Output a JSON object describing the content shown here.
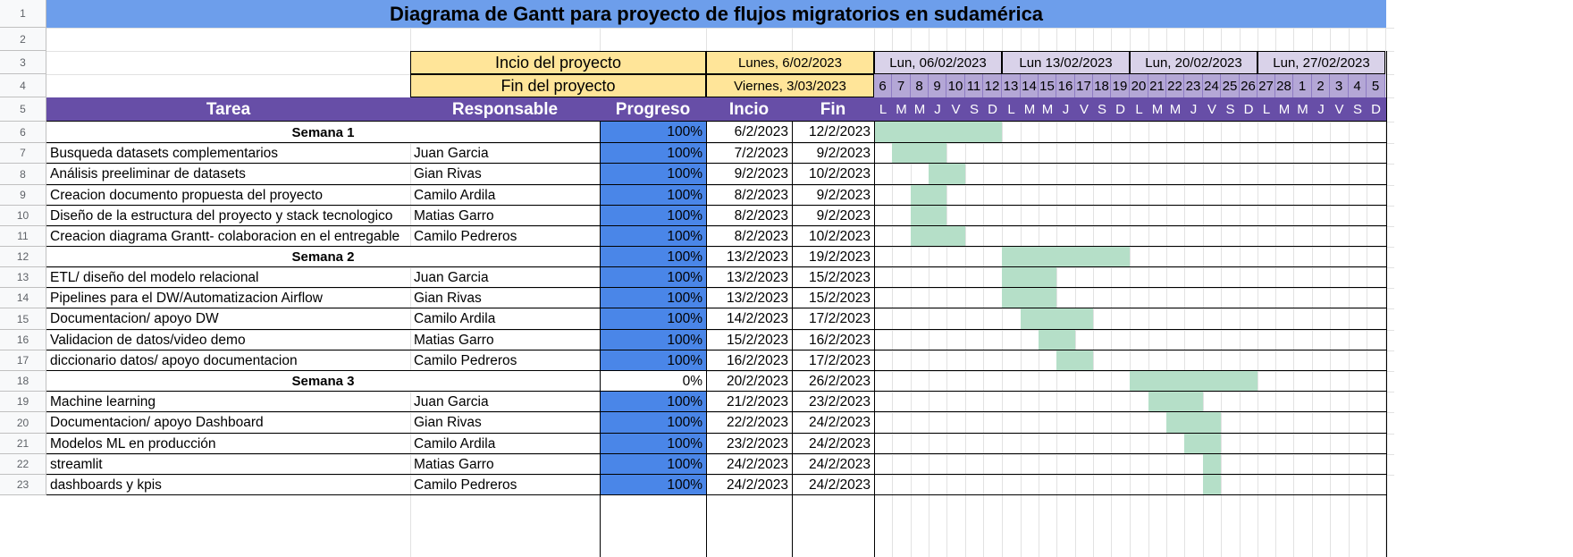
{
  "title": "Diagrama de Gantt para proyecto de flujos migratorios en sudamérica",
  "project": {
    "start_label": "Incio del proyecto",
    "start_value": "Lunes, 6/02/2023",
    "end_label": "Fin del proyecto",
    "end_value": "Viernes, 3/03/2023"
  },
  "weeks": [
    "Lun, 06/02/2023",
    "Lun 13/02/2023",
    "Lun, 20/02/2023",
    "Lun, 27/02/2023"
  ],
  "day_numbers": [
    "6",
    "7",
    "8",
    "9",
    "10",
    "11",
    "12",
    "13",
    "14",
    "15",
    "16",
    "17",
    "18",
    "19",
    "20",
    "21",
    "22",
    "23",
    "24",
    "25",
    "26",
    "27",
    "28",
    "1",
    "2",
    "3",
    "4",
    "5"
  ],
  "day_letters": [
    "L",
    "M",
    "M",
    "J",
    "V",
    "S",
    "D",
    "L",
    "M",
    "M",
    "J",
    "V",
    "S",
    "D",
    "L",
    "M",
    "M",
    "J",
    "V",
    "S",
    "D",
    "L",
    "M",
    "M",
    "J",
    "V",
    "S",
    "D"
  ],
  "headers": {
    "task": "Tarea",
    "owner": "Responsable",
    "progress": "Progreso",
    "start": "Incio",
    "end": "Fin"
  },
  "row_numbers": [
    "1",
    "2",
    "3",
    "4",
    "5",
    "6",
    "7",
    "8",
    "9",
    "10",
    "11",
    "12",
    "13",
    "14",
    "15",
    "16",
    "17",
    "18",
    "19",
    "20",
    "21",
    "22",
    "23"
  ],
  "rows": [
    {
      "task": "Semana 1",
      "owner": "",
      "progress": "100%",
      "start": "6/2/2023",
      "end": "12/2/2023",
      "week": true,
      "bar_start_day": 0,
      "bar_days": 7
    },
    {
      "task": "Busqueda datasets complementarios",
      "owner": "Juan Garcia",
      "progress": "100%",
      "start": "7/2/2023",
      "end": "9/2/2023",
      "bar_start_day": 1,
      "bar_days": 3
    },
    {
      "task": "Análisis preeliminar de datasets",
      "owner": "Gian Rivas",
      "progress": "100%",
      "start": "9/2/2023",
      "end": "10/2/2023",
      "bar_start_day": 3,
      "bar_days": 2
    },
    {
      "task": "Creacion documento propuesta del proyecto",
      "owner": "Camilo Ardila",
      "progress": "100%",
      "start": "8/2/2023",
      "end": "9/2/2023",
      "bar_start_day": 2,
      "bar_days": 2
    },
    {
      "task": "Diseño de la estructura del proyecto y stack tecnologico",
      "owner": "Matias Garro",
      "progress": "100%",
      "start": "8/2/2023",
      "end": "9/2/2023",
      "bar_start_day": 2,
      "bar_days": 2
    },
    {
      "task": "Creacion diagrama Grantt- colaboracion en el entregable",
      "owner": "Camilo Pedreros",
      "progress": "100%",
      "start": "8/2/2023",
      "end": "10/2/2023",
      "bar_start_day": 2,
      "bar_days": 3
    },
    {
      "task": "Semana 2",
      "owner": "",
      "progress": "100%",
      "start": "13/2/2023",
      "end": "19/2/2023",
      "week": true,
      "bar_start_day": 7,
      "bar_days": 7
    },
    {
      "task": "ETL/ diseño del modelo relacional",
      "owner": " Juan Garcia",
      "progress": "100%",
      "start": "13/2/2023",
      "end": "15/2/2023",
      "bar_start_day": 7,
      "bar_days": 3
    },
    {
      "task": "Pipelines para el DW/Automatizacion Airflow",
      "owner": "Gian Rivas",
      "progress": "100%",
      "start": "13/2/2023",
      "end": "15/2/2023",
      "bar_start_day": 7,
      "bar_days": 3
    },
    {
      "task": "Documentacion/ apoyo DW",
      "owner": "Camilo Ardila",
      "progress": "100%",
      "start": "14/2/2023",
      "end": "17/2/2023",
      "bar_start_day": 8,
      "bar_days": 4
    },
    {
      "task": "Validacion de datos/video demo",
      "owner": "Matias Garro",
      "progress": "100%",
      "start": "15/2/2023",
      "end": "16/2/2023",
      "bar_start_day": 9,
      "bar_days": 2
    },
    {
      "task": "diccionario datos/ apoyo documentacion",
      "owner": "Camilo Pedreros",
      "progress": "100%",
      "start": "16/2/2023",
      "end": "17/2/2023",
      "bar_start_day": 10,
      "bar_days": 2
    },
    {
      "task": "Semana 3",
      "owner": "",
      "progress": "0%",
      "start": "20/2/2023",
      "end": "26/2/2023",
      "week": true,
      "bar_start_day": 14,
      "bar_days": 7
    },
    {
      "task": "Machine learning",
      "owner": "Juan Garcia",
      "progress": "100%",
      "start": "21/2/2023",
      "end": "23/2/2023",
      "bar_start_day": 15,
      "bar_days": 3
    },
    {
      "task": "Documentacion/ apoyo Dashboard",
      "owner": "Gian Rivas",
      "progress": "100%",
      "start": "22/2/2023",
      "end": "24/2/2023",
      "bar_start_day": 16,
      "bar_days": 3
    },
    {
      "task": "Modelos ML en producción",
      "owner": "Camilo Ardila",
      "progress": "100%",
      "start": "23/2/2023",
      "end": "24/2/2023",
      "bar_start_day": 17,
      "bar_days": 2
    },
    {
      "task": "streamlit",
      "owner": "Matias Garro",
      "progress": "100%",
      "start": "24/2/2023",
      "end": "24/2/2023",
      "bar_start_day": 18,
      "bar_days": 1
    },
    {
      "task": "dashboards y kpis",
      "owner": "Camilo Pedreros",
      "progress": "100%",
      "start": "24/2/2023",
      "end": "24/2/2023",
      "bar_start_day": 18,
      "bar_days": 1
    }
  ],
  "colors": {
    "title_bg": "#6d9eeb",
    "header_bg": "#674ea7",
    "project_bg": "#ffe599",
    "week_bg": "#d9d2e9",
    "days_bg": "#b4a7d6",
    "progress_fill": "#4a86e8",
    "bar_fill": "#b5dfc8"
  }
}
